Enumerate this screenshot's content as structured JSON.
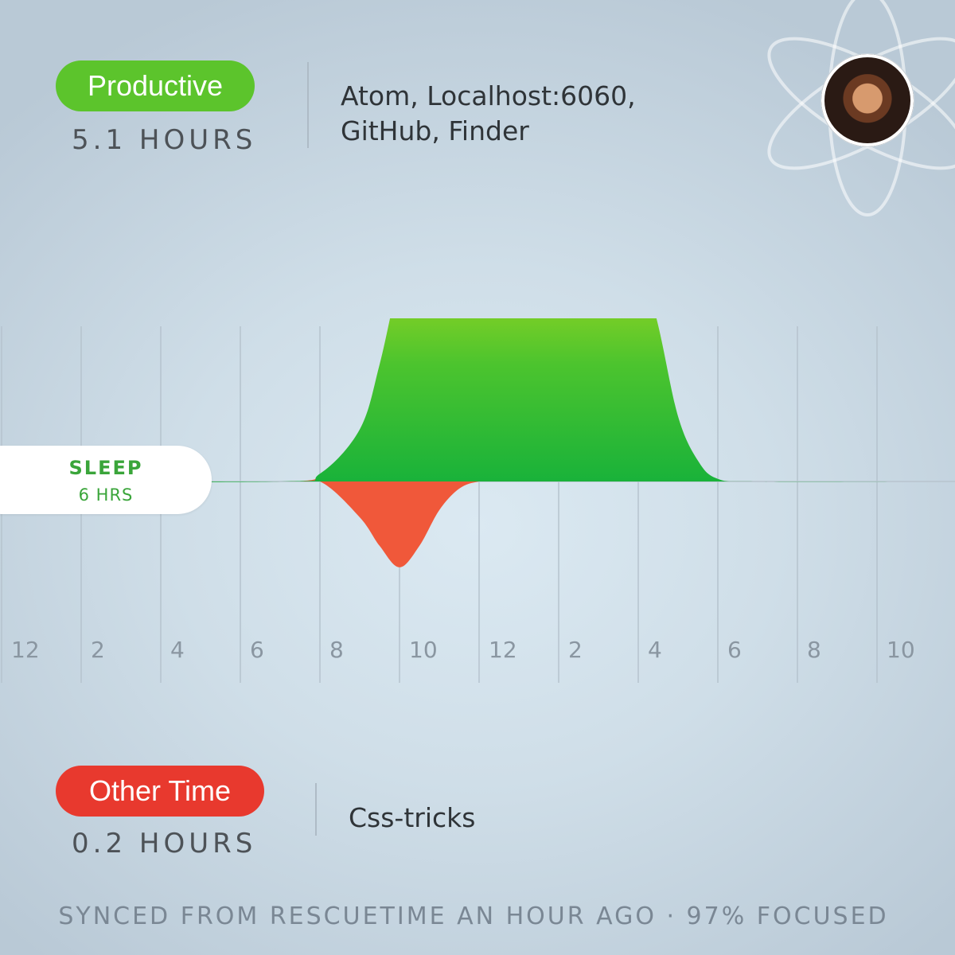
{
  "productive": {
    "label": "Productive",
    "hours": "5.1 HOURS",
    "apps": [
      "Atom, Localhost:6060,",
      "GitHub, Finder"
    ]
  },
  "other": {
    "label": "Other Time",
    "hours": "0.2 HOURS",
    "apps": [
      "Css-tricks"
    ]
  },
  "sleep": {
    "label": "SLEEP",
    "hours": "6 HRS"
  },
  "footer": "SYNCED FROM RESCUETIME AN HOUR AGO · 97% FOCUSED",
  "colors": {
    "productive": "#5cc42c",
    "other": "#e8392e",
    "curve_top": "#c8e01a",
    "curve_bottom": "#19b23a",
    "negative": "#f0583a"
  },
  "icons": {
    "logo": "atom-logo-icon",
    "avatar": "user-avatar"
  },
  "chart_data": {
    "type": "area",
    "x_tick_labels": [
      "12",
      "2",
      "4",
      "6",
      "8",
      "10",
      "12",
      "2",
      "4",
      "6",
      "8",
      "10"
    ],
    "x": [
      0,
      7,
      8,
      9,
      9.5,
      10,
      10.5,
      11,
      11.5,
      12,
      12.5,
      13,
      13.5,
      14,
      14.5,
      15,
      15.5,
      16,
      16.5,
      17,
      17.5,
      18,
      19,
      23
    ],
    "series": [
      {
        "values": [
          0,
          0,
          0.03,
          0.2,
          0.45,
          0.78,
          0.97,
          1.0,
          0.92,
          0.85,
          0.92,
          1.0,
          0.97,
          0.88,
          0.85,
          0.92,
          0.94,
          0.88,
          0.6,
          0.25,
          0.08,
          0.01,
          0,
          0
        ]
      },
      {
        "values": [
          0,
          0,
          0,
          -0.05,
          -0.09,
          -0.12,
          -0.09,
          -0.04,
          -0.01,
          0,
          0,
          0,
          0,
          0,
          0,
          0,
          0,
          0,
          0,
          0,
          0,
          0,
          0,
          0
        ]
      }
    ],
    "grid": true
  }
}
